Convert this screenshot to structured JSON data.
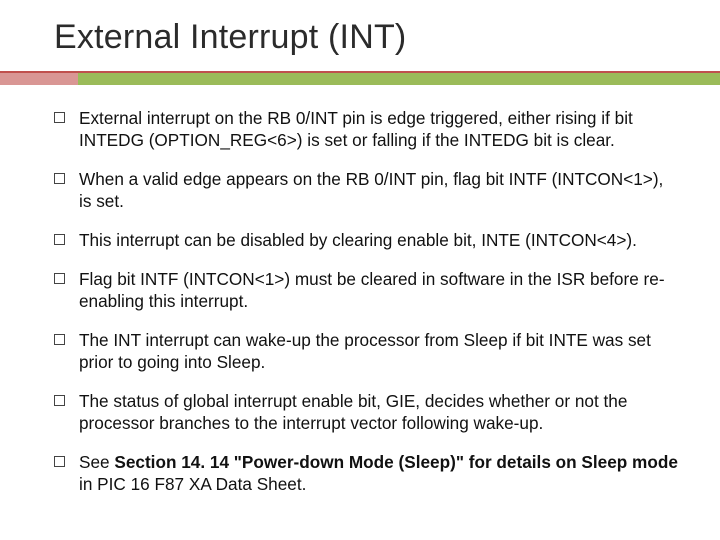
{
  "title": "External Interrupt (INT)",
  "bullets": [
    {
      "text": "External interrupt on the RB 0/INT pin is edge triggered, either rising if bit INTEDG (OPTION_REG<6>) is set or falling if the INTEDG bit is clear."
    },
    {
      "text": "When a valid edge appears on the RB 0/INT pin, flag bit INTF (INTCON<1>), is set."
    },
    {
      "text": "This interrupt can be disabled by clearing enable bit, INTE (INTCON<4>)."
    },
    {
      "text": "Flag bit INTF (INTCON<1>) must be cleared in software in the ISR before re-enabling this interrupt."
    },
    {
      "text": "The INT interrupt can wake-up the processor from Sleep if bit INTE was set prior to going into Sleep."
    },
    {
      "text": "The status of global interrupt enable bit, GIE, decides whether or not the processor branches to the interrupt vector following wake-up."
    },
    {
      "prefix": "See ",
      "bold": "Section 14. 14 \"Power-down Mode (Sleep)\" for details on Sleep mode",
      "suffix": " in PIC 16 F87 XA Data Sheet."
    }
  ]
}
